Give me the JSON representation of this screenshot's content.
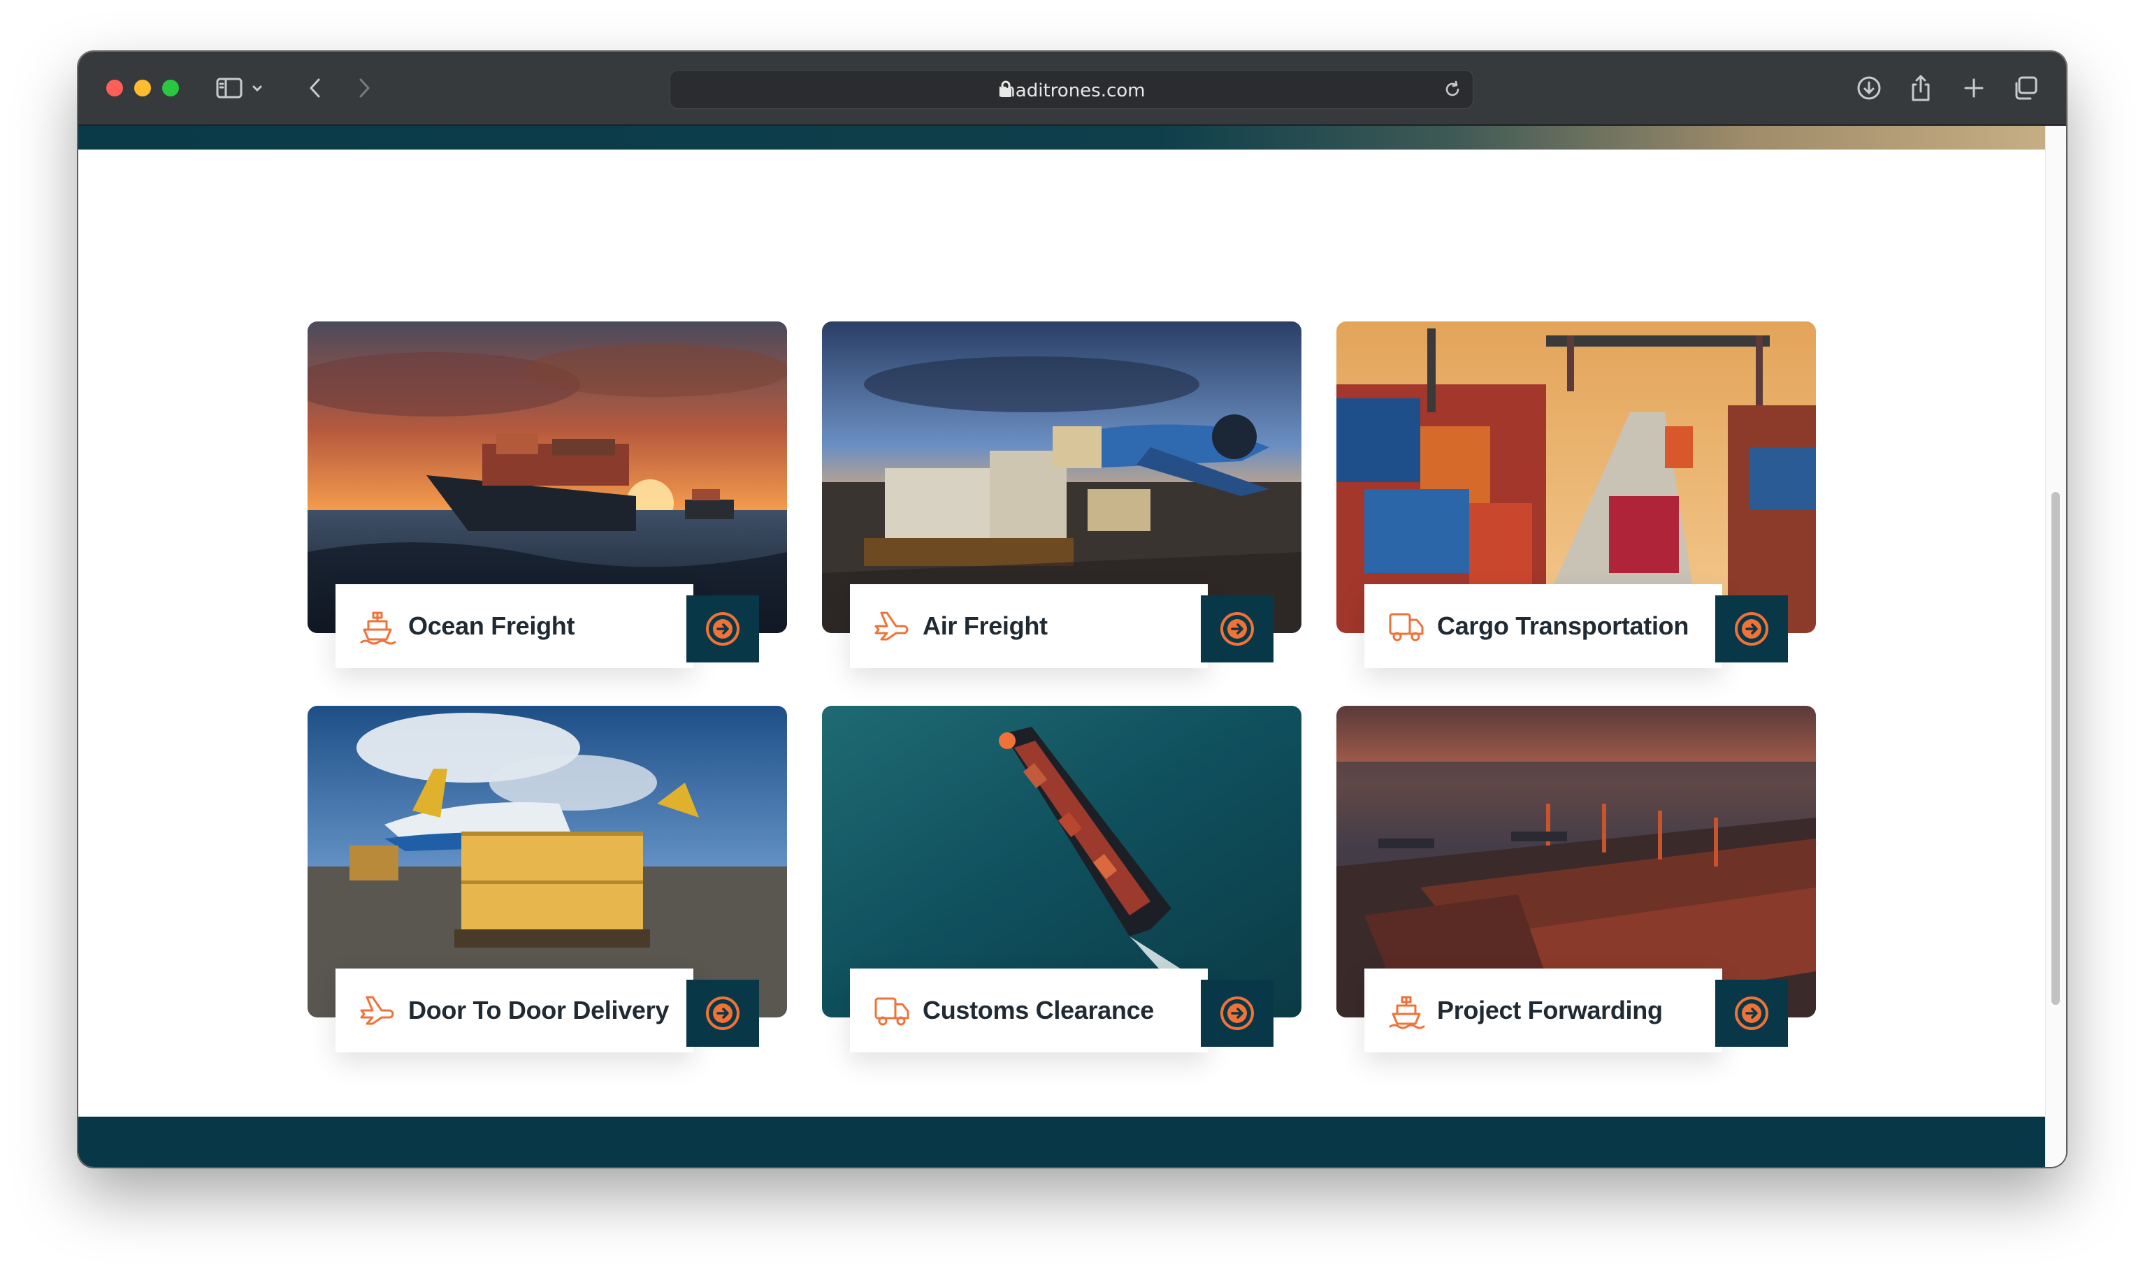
{
  "browser": {
    "url": "maditrones.com"
  },
  "colors": {
    "accent": "#f07238",
    "dark_teal": "#083847",
    "title_text": "#1f2a33"
  },
  "services": [
    {
      "title": "Ocean Freight",
      "icon": "ship-icon",
      "image": "cargo-ship-at-sunset"
    },
    {
      "title": "Air Freight",
      "icon": "plane-icon",
      "image": "cargo-plane-loading"
    },
    {
      "title": "Cargo Transportation",
      "icon": "truck-icon",
      "image": "container-port-trucks"
    },
    {
      "title": "Door To Door Delivery",
      "icon": "plane-icon",
      "image": "airplane-with-pallets"
    },
    {
      "title": "Customs Clearance",
      "icon": "truck-icon",
      "image": "aerial-container-ship"
    },
    {
      "title": "Project Forwarding",
      "icon": "ship-icon",
      "image": "port-at-dusk"
    }
  ]
}
